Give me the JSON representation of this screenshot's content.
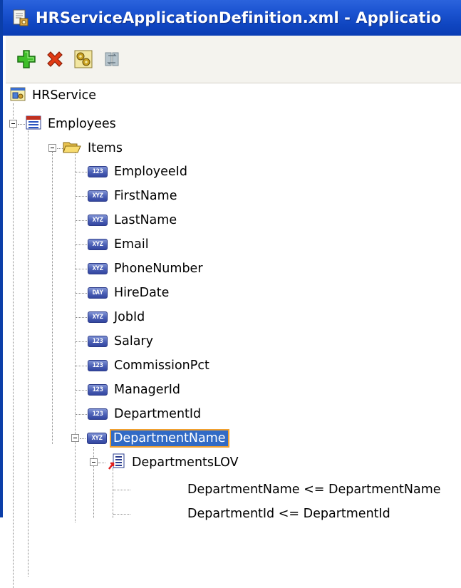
{
  "window": {
    "title": "HRServiceApplicationDefinition.xml - Applicatio"
  },
  "toolbar": {
    "buttons": [
      {
        "icon": "add-icon"
      },
      {
        "icon": "delete-icon"
      },
      {
        "icon": "gears-icon"
      },
      {
        "icon": "refresh-icon"
      }
    ]
  },
  "tree": {
    "root": "HRService",
    "view": "Employees",
    "items_folder": "Items",
    "items": [
      {
        "badge": "123",
        "label": "EmployeeId"
      },
      {
        "badge": "XYZ",
        "label": "FirstName"
      },
      {
        "badge": "XYZ",
        "label": "LastName"
      },
      {
        "badge": "XYZ",
        "label": "Email"
      },
      {
        "badge": "XYZ",
        "label": "PhoneNumber"
      },
      {
        "badge": "DAY",
        "label": "HireDate"
      },
      {
        "badge": "XYZ",
        "label": "JobId"
      },
      {
        "badge": "123",
        "label": "Salary"
      },
      {
        "badge": "123",
        "label": "CommissionPct"
      },
      {
        "badge": "123",
        "label": "ManagerId"
      },
      {
        "badge": "123",
        "label": "DepartmentId"
      }
    ],
    "selected_item": {
      "badge": "XYZ",
      "label": "DepartmentName"
    },
    "lov": "DepartmentsLOV",
    "mappings": [
      "DepartmentName <= DepartmentName",
      "DepartmentId <= DepartmentId"
    ]
  },
  "colors": {
    "titlebar": "#0f45c0",
    "selection": "#316ac5",
    "selection_outline": "#f0a030"
  }
}
